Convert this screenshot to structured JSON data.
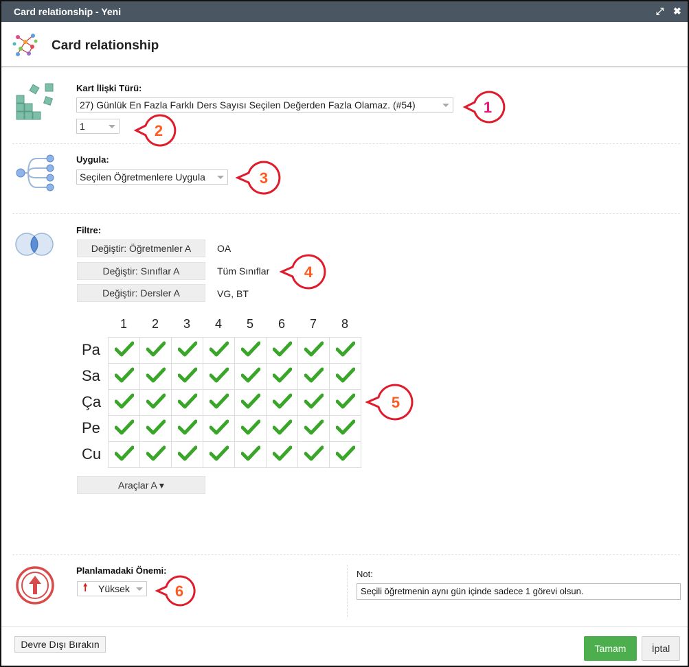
{
  "window": {
    "title": "Card relationship - Yeni",
    "header_title": "Card relationship"
  },
  "relation_type": {
    "label": "Kart İlişki Türü:",
    "selected": "27) Günlük En Fazla Farklı Ders Sayısı Seçilen Değerden Fazla Olamaz. (#54)",
    "value_selected": "1"
  },
  "apply": {
    "label": "Uygula:",
    "selected": "Seçilen Öğretmenlere Uygula"
  },
  "filter": {
    "label": "Filtre:",
    "rows": [
      {
        "button": "Değiştir: Öğretmenler A",
        "value": "OA"
      },
      {
        "button": "Değiştir: Sınıflar A",
        "value": "Tüm Sınıflar"
      },
      {
        "button": "Değiştir: Dersler A",
        "value": "VG, BT"
      }
    ]
  },
  "grid": {
    "columns": [
      "1",
      "2",
      "3",
      "4",
      "5",
      "6",
      "7",
      "8"
    ],
    "rows": [
      "Pa",
      "Sa",
      "Ça",
      "Pe",
      "Cu"
    ],
    "all_checked": true,
    "check_color": "#3aa629"
  },
  "tools_button": "Araçlar A ▾",
  "importance": {
    "label": "Planlamadaki Önemi:",
    "selected": "Yüksek"
  },
  "note": {
    "label": "Not:",
    "value": "Seçili öğretmenin aynı gün içinde sadece 1 görevi olsun."
  },
  "footer": {
    "disable_label": "Devre Dışı Bırakın",
    "ok_label": "Tamam",
    "cancel_label": "İptal"
  },
  "callouts": [
    "1",
    "2",
    "3",
    "4",
    "5",
    "6"
  ],
  "colors": {
    "titlebar": "#4a5763",
    "callout_ring": "#e01b2b",
    "callout_text_1": "#e8187a",
    "callout_text_other": "#ff5a1f",
    "ok_button": "#4cae4c"
  }
}
